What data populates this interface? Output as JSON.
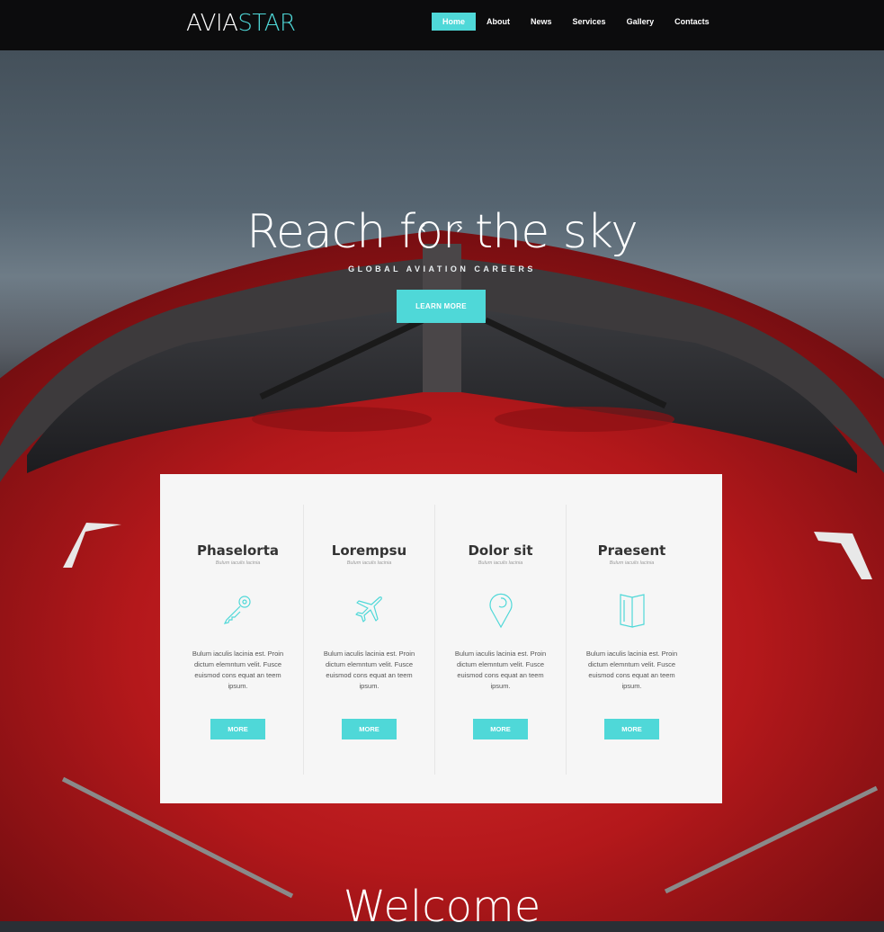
{
  "header": {
    "logo_part1": "AVIA",
    "logo_part2": "STAR",
    "nav": [
      {
        "label": "Home",
        "active": true
      },
      {
        "label": "About"
      },
      {
        "label": "News"
      },
      {
        "label": "Services"
      },
      {
        "label": "Gallery"
      },
      {
        "label": "Contacts"
      }
    ]
  },
  "hero": {
    "prev_arrow": "‹",
    "next_arrow": "›",
    "title": "Reach for the sky",
    "subtitle": "GLOBAL AVIATION CAREERS",
    "button": "LEARN MORE"
  },
  "features": [
    {
      "title": "Phaselorta",
      "subtitle": "Bulum iaculis lacinia",
      "icon": "key-icon",
      "text": "Bulum iaculis lacinia est. Proin dictum elemntum velit. Fusce euismod cons equat an teem ipsum.",
      "button": "MORE"
    },
    {
      "title": "Lorempsu",
      "subtitle": "Bulum iaculis lacinia",
      "icon": "plane-icon",
      "text": "Bulum iaculis lacinia est. Proin dictum elemntum velit. Fusce euismod cons equat an teem ipsum.",
      "button": "MORE"
    },
    {
      "title": "Dolor sit",
      "subtitle": "Bulum iaculis lacinia",
      "icon": "location-pin-icon",
      "text": "Bulum iaculis lacinia est. Proin dictum elemntum velit. Fusce euismod cons equat an teem ipsum.",
      "button": "MORE"
    },
    {
      "title": "Praesent",
      "subtitle": "Bulum iaculis lacinia",
      "icon": "brochure-icon",
      "text": "Bulum iaculis lacinia est. Proin dictum elemntum velit. Fusce euismod cons equat an teem ipsum.",
      "button": "MORE"
    }
  ],
  "welcome": "Welcome",
  "colors": {
    "accent": "#4fd8d8",
    "header_bg": "#0c0c0d",
    "panel_bg": "#f6f6f6",
    "plane_red": "#b8191c"
  }
}
